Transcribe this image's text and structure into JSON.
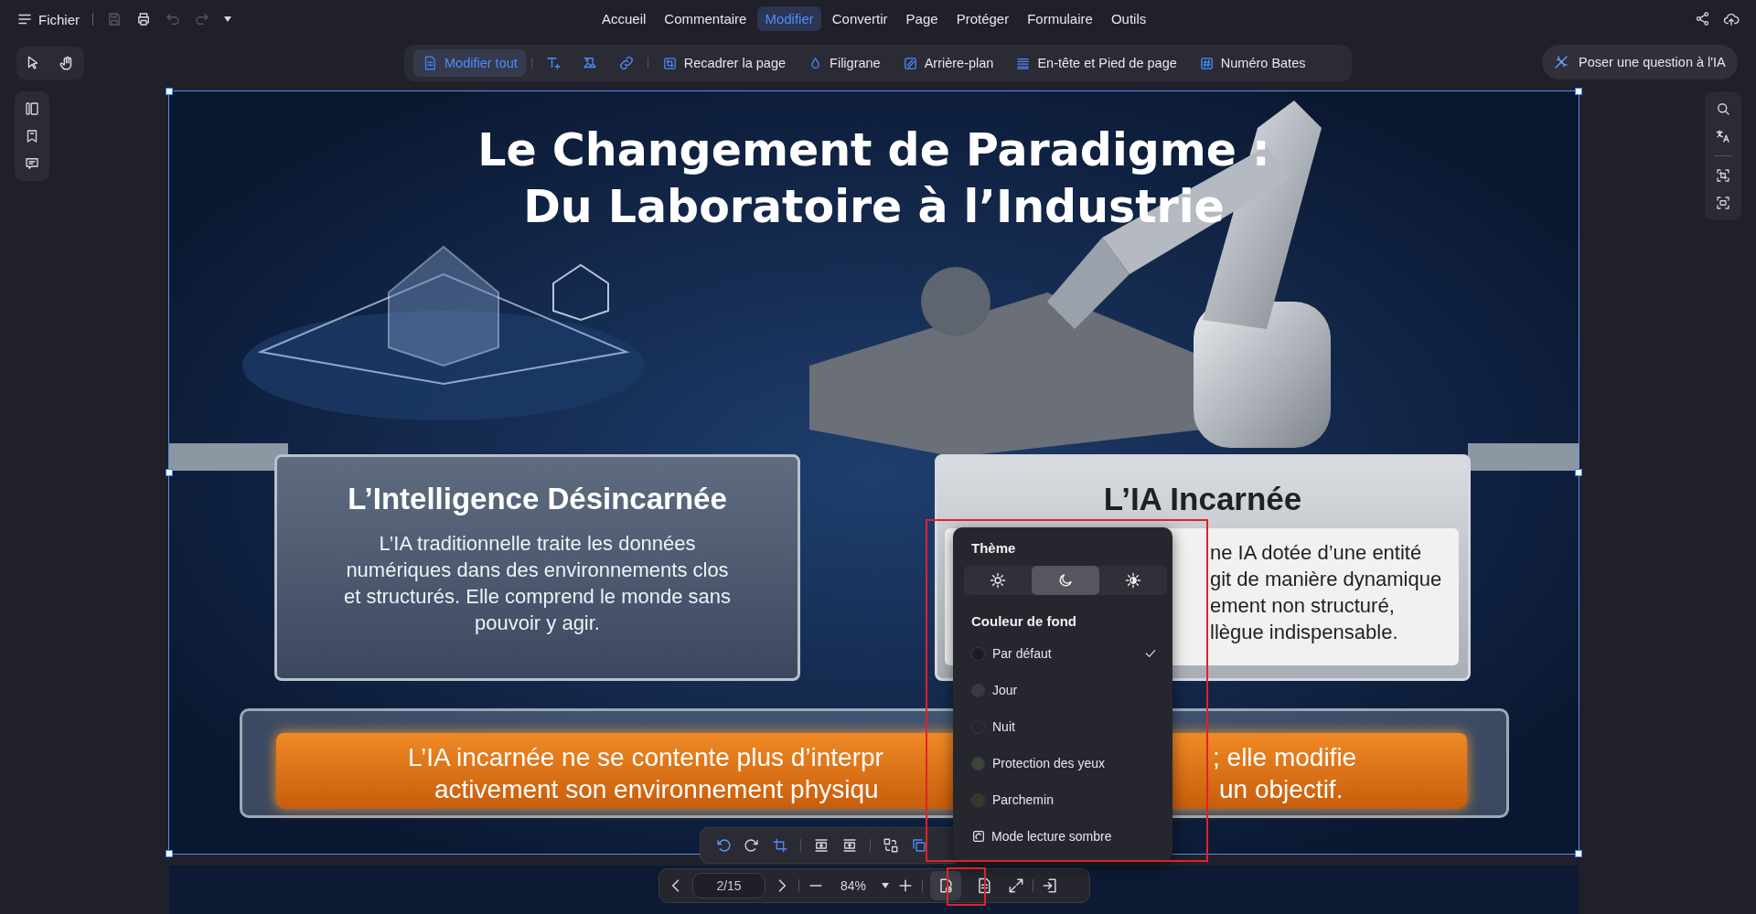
{
  "menu_bar": {
    "file_label": "Fichier",
    "quick_actions": [
      {
        "kind": "save",
        "disabled": true
      },
      {
        "kind": "print",
        "disabled": false
      },
      {
        "kind": "undo",
        "disabled": true
      },
      {
        "kind": "redo",
        "disabled": true
      }
    ],
    "tabs": [
      {
        "label": "Accueil",
        "selected": false
      },
      {
        "label": "Commentaire",
        "selected": false
      },
      {
        "label": "Modifier",
        "selected": true
      },
      {
        "label": "Convertir",
        "selected": false
      },
      {
        "label": "Page",
        "selected": false
      },
      {
        "label": "Protéger",
        "selected": false
      },
      {
        "label": "Formulaire",
        "selected": false
      },
      {
        "label": "Outils",
        "selected": false
      }
    ]
  },
  "edit_tools": [
    {
      "label": "Modifier tout",
      "selected": true
    },
    {
      "label": "Recadrer la page",
      "selected": false
    },
    {
      "label": "Filigrane",
      "selected": false
    },
    {
      "label": "Arrière-plan",
      "selected": false
    },
    {
      "label": "En-tête et Pied de page",
      "selected": false
    },
    {
      "label": "Numéro Bates",
      "selected": false
    }
  ],
  "ai_button": {
    "label": "Poser une question à l'IA"
  },
  "document": {
    "title": "Le Changement de Paradigme :\nDu Laboratoire à l’Industrie",
    "left_card": {
      "heading": "L’Intelligence Désincarnée",
      "body": "L’IA traditionnelle traite les données numériques dans des environnements clos et structurés. Elle comprend le monde sans pouvoir y agir."
    },
    "right_card": {
      "heading": "L’IA Incarnée",
      "body_fragments": [
        "ne IA dotée d’une entité",
        "git de manière dynamique",
        "ement non structuré,",
        "llègue indispensable."
      ]
    },
    "banner_fragments": [
      "L’IA incarnée ne se contente plus d’interpr",
      "; elle modifie",
      "activement son environnement physiqu",
      "un objectif."
    ]
  },
  "page_nav": {
    "page": "2/15",
    "zoom": "84%",
    "view_modes": [
      {
        "kind": "reading",
        "selected": true
      },
      {
        "kind": "page",
        "selected": false
      }
    ]
  },
  "theme_menu": {
    "title": "Thème",
    "themes": [
      {
        "kind": "light",
        "selected": false
      },
      {
        "kind": "dark",
        "selected": true
      },
      {
        "kind": "auto",
        "selected": false
      }
    ],
    "background_title": "Couleur de fond",
    "backgrounds": [
      {
        "label": "Par défaut",
        "color": "#1b1c22",
        "selected": true
      },
      {
        "label": "Jour",
        "color": "#393a40",
        "selected": false
      },
      {
        "label": "Nuit",
        "color": "#25262c",
        "selected": false
      },
      {
        "label": "Protection des yeux",
        "color": "#3b4538",
        "selected": false
      },
      {
        "label": "Parchemin",
        "color": "#3d3627",
        "selected": false
      }
    ],
    "dark_reading_label": "Mode lecture sombre"
  }
}
